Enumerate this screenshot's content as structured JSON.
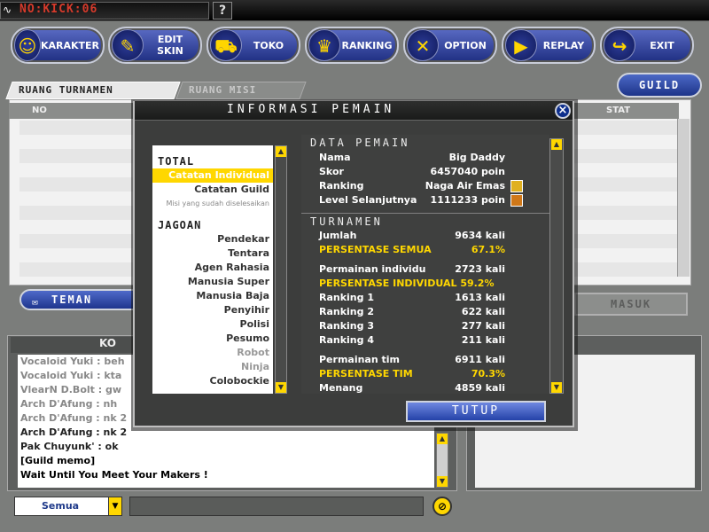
{
  "titlebar": {
    "title": "NO:KICK:06",
    "help": "?"
  },
  "menu": [
    {
      "label": "KARAKTER",
      "icon": "karakter-icon"
    },
    {
      "label": "EDIT SKIN",
      "icon": "edit-skin-icon"
    },
    {
      "label": "TOKO",
      "icon": "cart-icon"
    },
    {
      "label": "RANKING",
      "icon": "trophy-icon"
    },
    {
      "label": "OPTION",
      "icon": "wrench-icon"
    },
    {
      "label": "REPLAY",
      "icon": "camera-icon"
    },
    {
      "label": "EXIT",
      "icon": "exit-icon"
    }
  ],
  "tabs": {
    "turnamen": "RUANG TURNAMEN",
    "misi": "RUANG MISI"
  },
  "guild_button": "GUILD",
  "room_list": {
    "col_no": "NO",
    "col_stat": "STAT"
  },
  "teman_button": "TEMAN",
  "masuk_button": "MASUK",
  "chat_header": "KO",
  "chat": [
    "Vocaloid Yuki : beh",
    "Vocaloid Yuki : kta",
    "VlearN D.Bolt : gw",
    "Arch D'Afung : nh",
    "Arch D'Afung : nk 2",
    "Arch D'Afung : nk 2",
    "Pak Chuyunk' : ok",
    "[Guild memo]",
    "Wait Until You Meet Your Makers !"
  ],
  "channel": "Semua",
  "modal": {
    "title": "INFORMASI PEMAIN",
    "left_list": {
      "total_head": "TOTAL",
      "total": [
        "Catatan Individual",
        "Catatan Guild",
        "Misi yang sudah diselesaikan"
      ],
      "jagoan_head": "JAGOAN",
      "jagoan": [
        "Pendekar",
        "Tentara",
        "Agen Rahasia",
        "Manusia Super",
        "Manusia Baja",
        "Penyihir",
        "Polisi",
        "Pesumo",
        "Robot",
        "Ninja",
        "Colobockie"
      ]
    },
    "data_head": "DATA PEMAIN",
    "data": [
      {
        "k": "Nama",
        "v": "Big Daddy"
      },
      {
        "k": "Skor",
        "v": "6457040 poin"
      },
      {
        "k": "Ranking",
        "v": "Naga Air Emas"
      },
      {
        "k": "Level Selanjutnya",
        "v": "1111233 poin"
      }
    ],
    "turnamen_head": "TURNAMEN",
    "turnamen": [
      {
        "k": "Jumlah",
        "v": "9634 kali"
      },
      {
        "k": "PERSENTASE SEMUA",
        "v": "67.1%"
      },
      {
        "k": "Permainan individu",
        "v": "2723 kali"
      },
      {
        "k": "PERSENTASE INDIVIDUAL 59.2%",
        "v": ""
      },
      {
        "k": "Ranking 1",
        "v": "1613 kali"
      },
      {
        "k": "Ranking 2",
        "v": "622 kali"
      },
      {
        "k": "Ranking 3",
        "v": "277 kali"
      },
      {
        "k": "Ranking 4",
        "v": "211 kali"
      },
      {
        "k": "Permainan tim",
        "v": "6911 kali"
      },
      {
        "k": "PERSENTASE TIM",
        "v": "70.3%"
      },
      {
        "k": "Menang",
        "v": "4859 kali"
      }
    ],
    "close_button": "TUTUP"
  }
}
